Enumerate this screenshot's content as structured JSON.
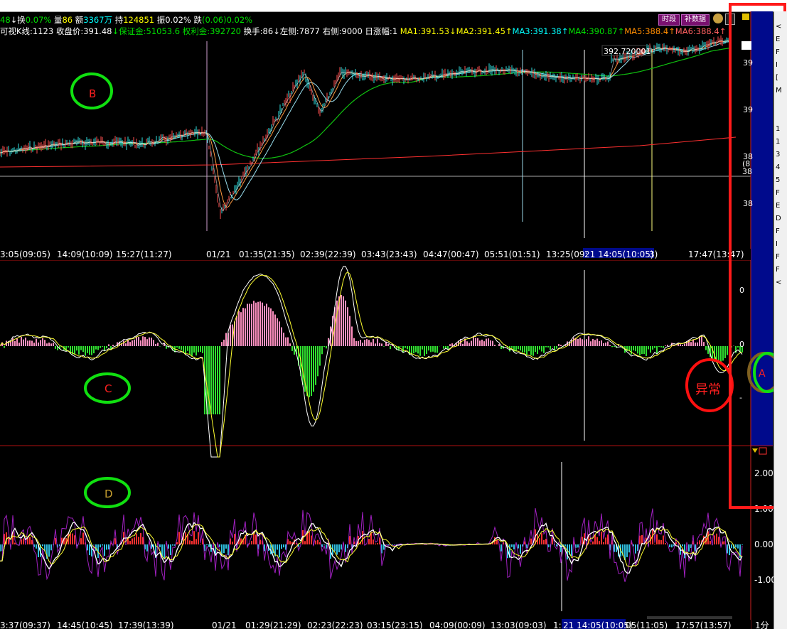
{
  "info_row1": [
    {
      "t": "48",
      "c": "#00e000"
    },
    {
      "t": "↓换",
      "c": "#ffffff"
    },
    {
      "t": "0.07%",
      "c": "#00e000"
    },
    {
      "t": " 量",
      "c": "#ffffff"
    },
    {
      "t": "86",
      "c": "#ffff00"
    },
    {
      "t": " 额",
      "c": "#ffffff"
    },
    {
      "t": "3367万",
      "c": "#00ffff"
    },
    {
      "t": " 持",
      "c": "#ffffff"
    },
    {
      "t": "124851",
      "c": "#ffff00"
    },
    {
      "t": " 振",
      "c": "#ffffff"
    },
    {
      "t": "0.02%",
      "c": "#ffffff"
    },
    {
      "t": " 跌",
      "c": "#ffffff"
    },
    {
      "t": "(0.06)",
      "c": "#00e000"
    },
    {
      "t": "0.02%",
      "c": "#00e000"
    }
  ],
  "info_row2": [
    {
      "t": " 可视K线:",
      "c": "#ffffff"
    },
    {
      "t": "1123",
      "c": "#ffffff"
    },
    {
      "t": "  收盘价:",
      "c": "#ffffff"
    },
    {
      "t": "391.48",
      "c": "#ffffff"
    },
    {
      "t": "↓保证金:",
      "c": "#00e000"
    },
    {
      "t": "51053.6",
      "c": "#00e000"
    },
    {
      "t": "  权利金:",
      "c": "#00e000"
    },
    {
      "t": "392720",
      "c": "#00e000"
    },
    {
      "t": "  换手:",
      "c": "#ffffff"
    },
    {
      "t": "86",
      "c": "#ffffff"
    },
    {
      "t": "↓左侧:",
      "c": "#ffffff"
    },
    {
      "t": "7877",
      "c": "#ffffff"
    },
    {
      "t": "  右侧:",
      "c": "#ffffff"
    },
    {
      "t": "9000",
      "c": "#ffffff"
    },
    {
      "t": "  日涨幅:",
      "c": "#ffffff"
    },
    {
      "t": "1",
      "c": "#ffffff"
    },
    {
      "t": "  MA1:",
      "c": "#ffff00"
    },
    {
      "t": "391.53↓",
      "c": "#ffff00"
    },
    {
      "t": "MA2:",
      "c": "#ffff00"
    },
    {
      "t": "391.45↑",
      "c": "#ffff00"
    },
    {
      "t": "MA3:",
      "c": "#00ffff"
    },
    {
      "t": "391.38↑",
      "c": "#00ffff"
    },
    {
      "t": "MA4:",
      "c": "#00e000"
    },
    {
      "t": "390.87↑",
      "c": "#00e000"
    },
    {
      "t": "MA5:",
      "c": "#ff8c00"
    },
    {
      "t": "388.4↑",
      "c": "#ff8c00"
    },
    {
      "t": "MA6:",
      "c": "#ff6060"
    },
    {
      "t": "388.4↑",
      "c": "#ff6060"
    }
  ],
  "buttons": {
    "period": "时段",
    "supplement": "补数据"
  },
  "price_label": "392.720001",
  "right_price_ticks": [
    "39",
    "39",
    "38",
    "38"
  ],
  "right_current": [
    "(8",
    "38"
  ],
  "time_axis_top": [
    "3:05(09:05)",
    "14:09(10:09)",
    "15:27(11:27)",
    "01/21",
    "01:35(21:35)",
    "02:39(22:39)",
    "03:43(23:43)",
    "04:47(00:47)",
    "05:51(01:51)",
    "13:25(09:",
    "21 14:05(10:05)",
    "3)",
    "17:47(13:47)"
  ],
  "time_axis_bottom": [
    "3:37(09:37)",
    "14:45(10:45)",
    "17:39(13:39)",
    "01/21",
    "01:29(21:29)",
    "02:23(22:23)",
    "03:15(23:15)",
    "04:09(00:09)",
    "13:03(09:03)",
    "1:",
    "21 14:05(10:05)",
    "05(11:05)",
    "17:57(13:57)",
    "1分"
  ],
  "macd_axis": [
    "0",
    "0",
    "-"
  ],
  "panel3_axis": [
    "2.00",
    "1.00",
    "0.00",
    "-1.00"
  ],
  "annotations": {
    "A": "A",
    "B": "B",
    "C": "C",
    "D": "D",
    "abnormal": "异常"
  },
  "right_sidebar_chars": [
    "<",
    "E",
    "F",
    "I",
    "[",
    "M",
    "",
    "",
    "1",
    "1",
    "3",
    "4",
    "5",
    "F",
    "E",
    "D",
    "F",
    "I",
    "F",
    "F",
    "<"
  ],
  "colors": {
    "annotation_green": "#10e010",
    "annotation_red": "#ff1010",
    "highlight_box": "#ff1a1a",
    "panel_blue": "#000a8c"
  }
}
